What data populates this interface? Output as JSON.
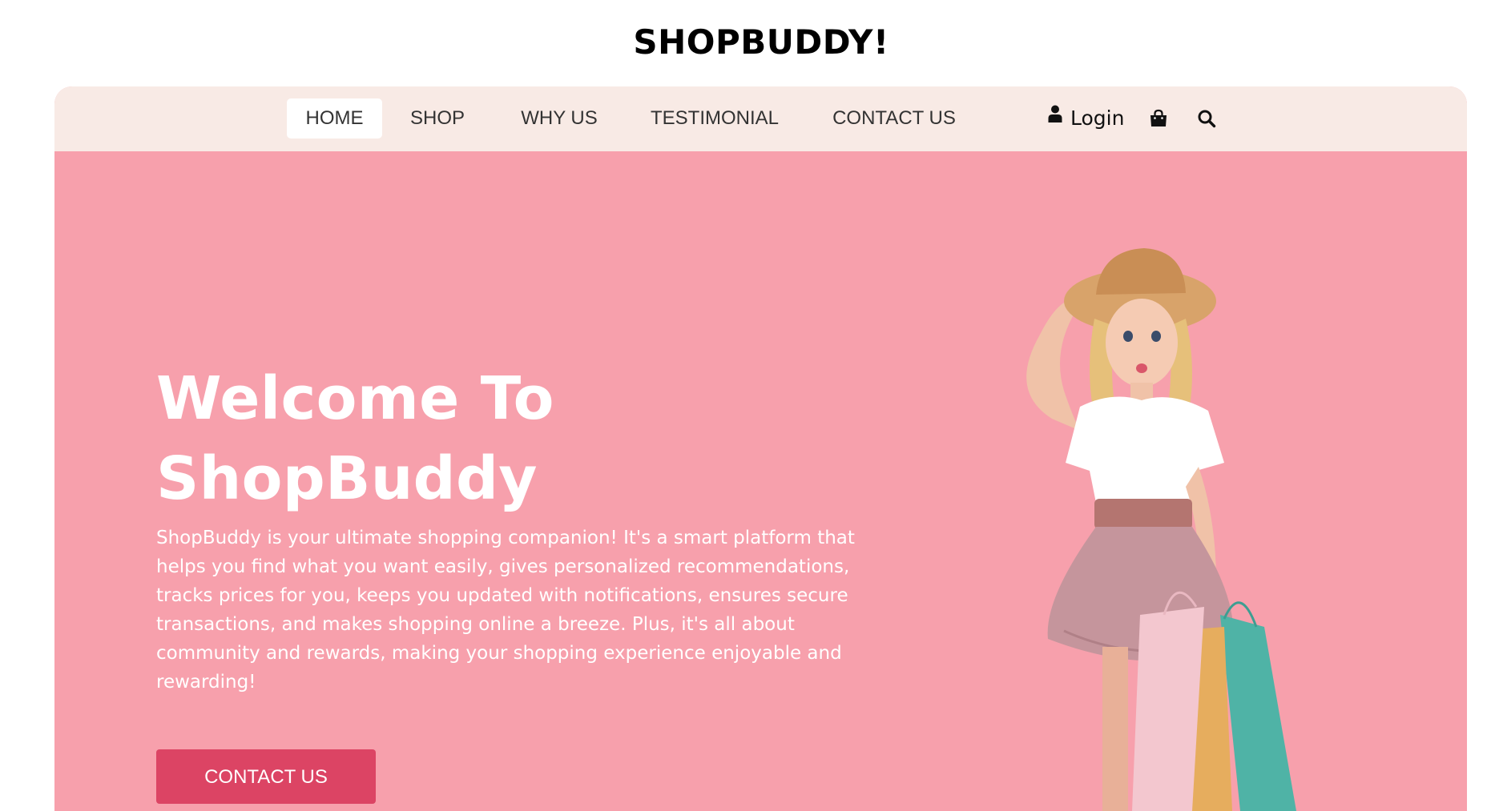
{
  "site": {
    "title": "SHOPBUDDY!"
  },
  "nav": {
    "items": [
      {
        "label": "HOME",
        "active": true
      },
      {
        "label": "SHOP",
        "active": false
      },
      {
        "label": "WHY US",
        "active": false
      },
      {
        "label": "TESTIMONIAL",
        "active": false
      },
      {
        "label": "CONTACT US",
        "active": false
      }
    ],
    "login_label": "Login",
    "icons": [
      "user-icon",
      "shopping-bag-icon",
      "search-icon"
    ]
  },
  "hero": {
    "title_line1": "Welcome To",
    "title_line2": "ShopBuddy",
    "description": "ShopBuddy is your ultimate shopping companion! It's a smart platform that helps you find what you want easily, gives personalized recommendations, tracks prices for you, keeps you updated with notifications, ensures secure transactions, and makes shopping online a breeze. Plus, it's all about community and rewards, making your shopping experience enjoyable and rewarding!",
    "cta_label": "CONTACT US"
  },
  "colors": {
    "hero_background": "#f7a0ac",
    "navbar_background": "#f8eae5",
    "cta_background": "#dc4464",
    "text_white": "#ffffff"
  }
}
